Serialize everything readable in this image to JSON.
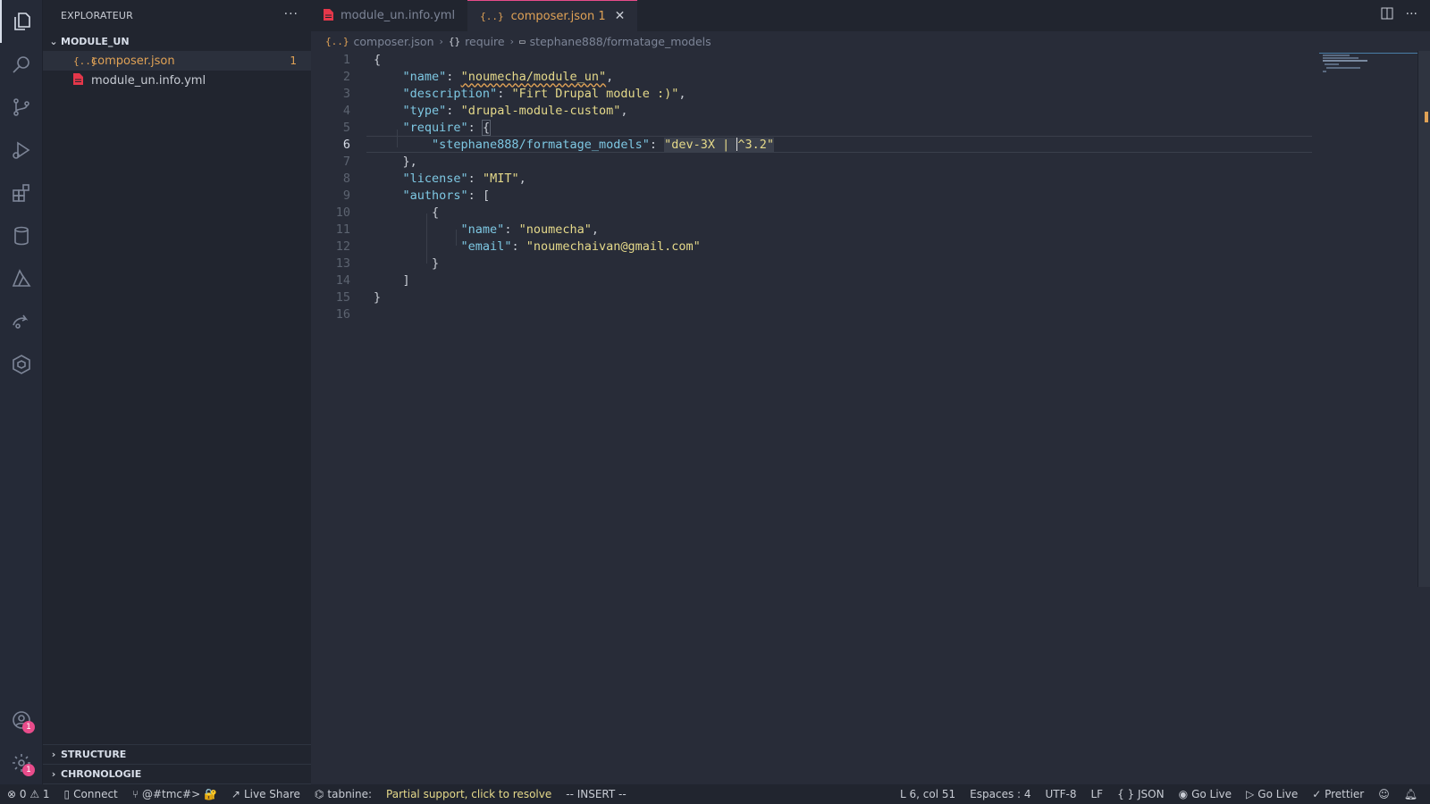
{
  "sidebar": {
    "title": "EXPLORATEUR",
    "more": "···",
    "folder": "MODULE_UN",
    "files": [
      {
        "name": "composer.json",
        "icon": "{..}",
        "count": "1"
      },
      {
        "name": "module_un.info.yml",
        "icon": "yml"
      }
    ],
    "sections": [
      "STRUCTURE",
      "CHRONOLOGIE"
    ]
  },
  "activity": {
    "items": [
      "explorer-icon",
      "search-icon",
      "source-control-icon",
      "run-debug-icon",
      "extensions-icon",
      "database-icon",
      "azure-icon",
      "live-share-icon",
      "kubernetes-icon"
    ],
    "account_badge": "1",
    "settings_badge": "1"
  },
  "tabs": [
    {
      "label": "module_un.info.yml",
      "icon": "yml"
    },
    {
      "label": "composer.json 1",
      "icon": "{..}",
      "close": "✕"
    }
  ],
  "breadcrumb": {
    "file": "composer.json",
    "object": "require",
    "key": "stephane888/formatage_models",
    "file_icon": "{..}",
    "object_icon": "{}"
  },
  "editor": {
    "line_numbers": [
      "1",
      "2",
      "3",
      "4",
      "5",
      "6",
      "7",
      "8",
      "9",
      "10",
      "11",
      "12",
      "13",
      "14",
      "15",
      "16"
    ],
    "current_line": 6,
    "lines": {
      "l1": "{",
      "l2_key": "\"name\"",
      "l2_val": "\"noumecha/module_un\"",
      "l3_key": "\"description\"",
      "l3_val": "\"Firt Drupal module :)\"",
      "l4_key": "\"type\"",
      "l4_val": "\"drupal-module-custom\"",
      "l5_key": "\"require\"",
      "l5_val": "{",
      "l6_key": "\"stephane888/formatage_models\"",
      "l6_val_a": "\"dev-3X | ",
      "l6_val_b": "^3.2\"",
      "l7": "},",
      "l8_key": "\"license\"",
      "l8_val": "\"MIT\"",
      "l9_key": "\"authors\"",
      "l9_val": "[",
      "l10": "{",
      "l11_key": "\"name\"",
      "l11_val": "\"noumecha\"",
      "l12_key": "\"email\"",
      "l12_val": "\"noumechaivan@gmail.com\"",
      "l13": "}",
      "l14": "]",
      "l15": "}"
    }
  },
  "status": {
    "problems": "⊗ 0 ⚠ 1",
    "connect": "Connect",
    "branch": "@#tmc#> 🔐",
    "live_share": "Live Share",
    "tabnine": "tabnine:",
    "partial": "Partial support, click to resolve",
    "mode": "-- INSERT --",
    "position": "L 6, col 51",
    "spaces": "Espaces : 4",
    "encoding": "UTF-8",
    "eol": "LF",
    "language": "{ } JSON",
    "go_live_1": "Go Live",
    "go_live_2": "Go Live",
    "prettier": "✓ Prettier"
  }
}
